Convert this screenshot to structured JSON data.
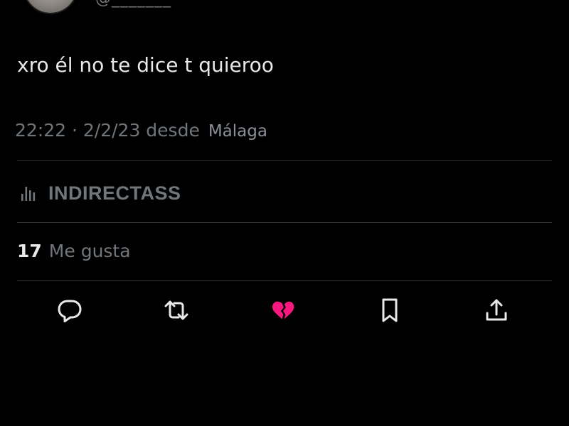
{
  "tweet": {
    "handle": "@_______",
    "text": "xro él no te dice t quieroo",
    "time_date": "22:22 · 2/2/23 desde",
    "location": "Málaga"
  },
  "analytics": {
    "label": "INDIRECTASS",
    "icon": "bar-chart-icon"
  },
  "likes": {
    "count": "17",
    "label": "Me gusta"
  },
  "actions": [
    {
      "name": "reply",
      "icon": "speech-bubble-icon"
    },
    {
      "name": "retweet",
      "icon": "retweet-arrows-icon"
    },
    {
      "name": "like",
      "icon": "broken-heart-icon",
      "color": "#f91880"
    },
    {
      "name": "bookmark",
      "icon": "bookmark-icon"
    },
    {
      "name": "share",
      "icon": "share-upload-icon"
    }
  ],
  "colors": {
    "background": "#000000",
    "text_primary": "#e7e9ea",
    "text_secondary": "#71767b",
    "divider": "#2f3336",
    "like_active": "#f91880"
  }
}
